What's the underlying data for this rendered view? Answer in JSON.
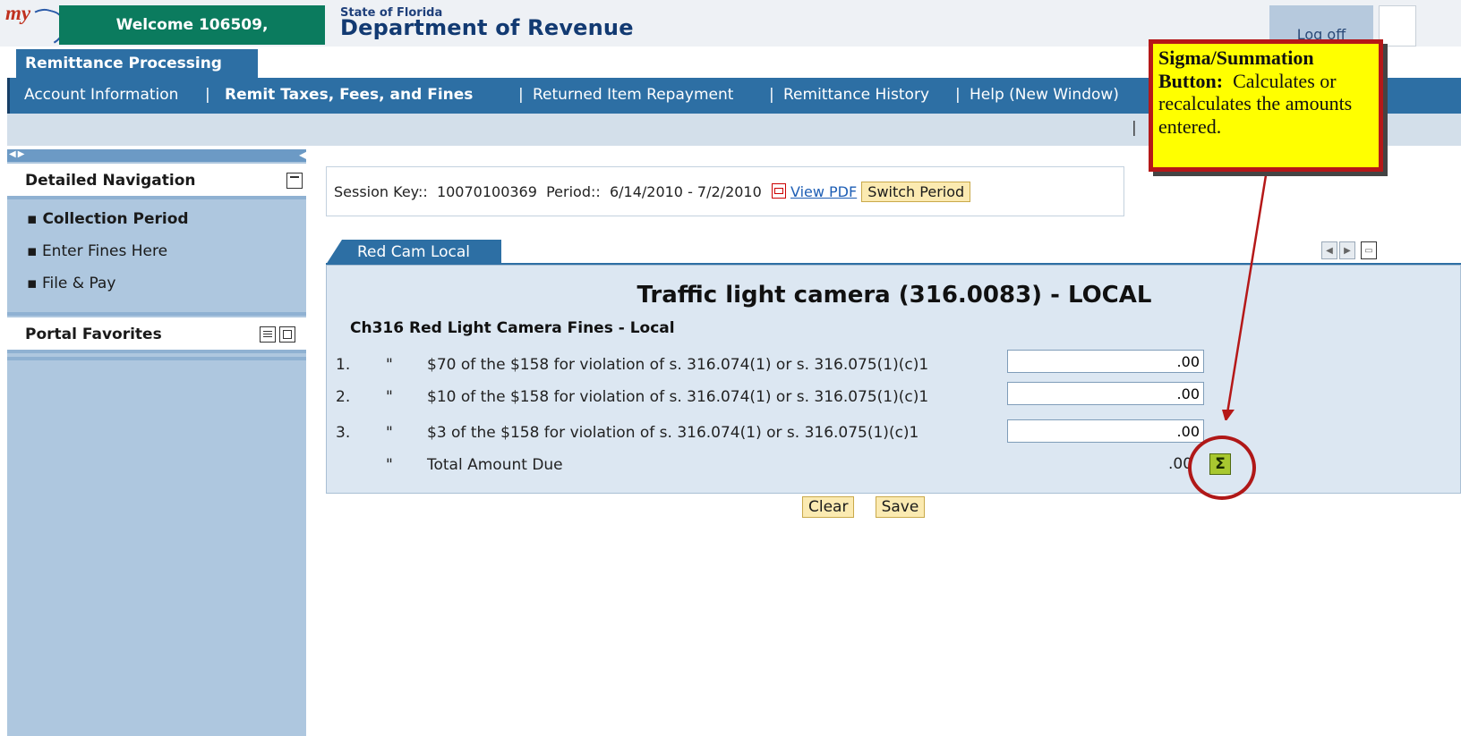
{
  "header": {
    "logo_text": "my",
    "welcome": "Welcome 106509,",
    "agency_small": "State of Florida",
    "agency_big": "Department of Revenue",
    "logoff": "Log off"
  },
  "nav": {
    "active_tab": "Remittance Processing",
    "items": [
      {
        "label": "Account Information",
        "active": false
      },
      {
        "label": "Remit Taxes, Fees, and Fines",
        "active": true
      },
      {
        "label": "Returned Item Repayment",
        "active": false
      },
      {
        "label": "Remittance History",
        "active": false
      },
      {
        "label": "Help (New Window)",
        "active": false
      }
    ]
  },
  "sidebar": {
    "detailed_nav_title": "Detailed Navigation",
    "items": [
      {
        "label": "Collection Period",
        "active": true
      },
      {
        "label": "Enter Fines Here",
        "active": false
      },
      {
        "label": "File & Pay",
        "active": false
      }
    ],
    "favorites_title": "Portal Favorites"
  },
  "session": {
    "key_label": "Session Key::",
    "key_value": "10070100369",
    "period_label": "Period::",
    "period_value": "6/14/2010 - 7/2/2010",
    "view_pdf": "View PDF",
    "switch_period": "Switch Period"
  },
  "tab": {
    "label": "Red Cam Local"
  },
  "form": {
    "title": "Traffic light camera (316.0083) - LOCAL",
    "subtitle": "Ch316 Red Light Camera Fines - Local",
    "rows": [
      {
        "num": "1.",
        "quote": "\"",
        "desc": "$70 of the $158 for violation of s. 316.074(1) or s. 316.075(1)(c)1",
        "value": ".00"
      },
      {
        "num": "2.",
        "quote": "\"",
        "desc": "$10 of the $158 for violation of s. 316.074(1) or s. 316.075(1)(c)1",
        "value": ".00"
      },
      {
        "num": "3.",
        "quote": "\"",
        "desc": "$3 of the $158 for violation of s. 316.074(1) or s. 316.075(1)(c)1",
        "value": ".00"
      }
    ],
    "total_quote": "\"",
    "total_label": "Total Amount Due",
    "total_value": ".00",
    "sigma_glyph": "Σ"
  },
  "actions": {
    "clear": "Clear",
    "save": "Save"
  },
  "callout": {
    "title": "Sigma/Summation Button:",
    "text": "Calculates or recalculates the amounts entered."
  },
  "colors": {
    "nav_blue": "#2d6fa4",
    "welcome_green": "#0b7b5e",
    "sidebar_blue": "#aec7df",
    "callout_yellow": "#ffff00",
    "callout_red": "#b51818"
  }
}
